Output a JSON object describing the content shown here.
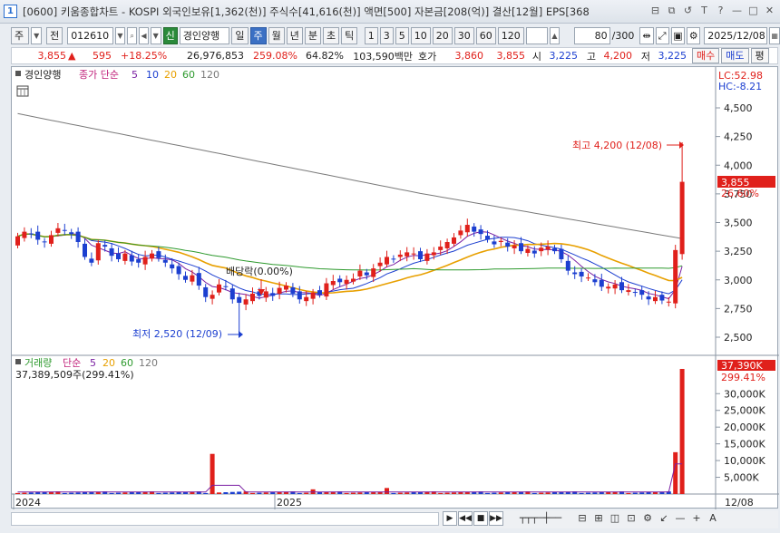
{
  "window": {
    "number": "1",
    "title": "[0600] 키움종합차트 - KOSPI 외국인보유[1,362(천)] 주식수[41,616(천)] 액면[500] 자본금[208(억)] 결산[12월] EPS[368",
    "controls": [
      "⊟",
      "⧉",
      "↺",
      "T",
      "?",
      "—",
      "□",
      "✕"
    ]
  },
  "toolbar": {
    "market": "주",
    "view": "전",
    "code": "012610",
    "sin": "신",
    "stock_name": "경인양행",
    "periods": [
      "일",
      "주",
      "월",
      "년",
      "분",
      "초",
      "틱"
    ],
    "selected_period": "주",
    "intervals": [
      "1",
      "3",
      "5",
      "10",
      "20",
      "30",
      "60",
      "120"
    ],
    "count": "80",
    "count_total": "/300",
    "date": "2025/12/08"
  },
  "quote": {
    "price": "3,855",
    "arrow": "▲",
    "change": "595",
    "change_pct": "+18.25%",
    "volume": "26,976,853",
    "volume_ratio": "259.08%",
    "strength": "64.82%",
    "amount": "103,590백만",
    "bid_label": "호가",
    "bid1": "3,860",
    "bid2": "3,855",
    "open_label": "시",
    "open": "3,225",
    "high_label": "고",
    "high": "4,200",
    "low_label": "저",
    "low": "3,225",
    "buy_label": "매수",
    "sell_label": "매도",
    "eval_label": "평"
  },
  "price_panel": {
    "legend_name": "경인양행",
    "legend_ma_label": "종가 단순",
    "ma_periods": [
      "5",
      "10",
      "20",
      "60",
      "120"
    ],
    "ma_colors": [
      "#7a1fa2",
      "#1c3fd0",
      "#e8a000",
      "#2e9a2e",
      "#7a7a7a"
    ],
    "lc": "LC:52.98",
    "hc": "HC:-8.21",
    "axis_ticks": [
      "4,500",
      "4,250",
      "4,000",
      "3,750",
      "3,500",
      "3,250",
      "3,000",
      "2,750",
      "2,500"
    ],
    "current_price": "3,855",
    "current_pct": "26.60%",
    "high_annotation": "최고 4,200 (12/08)",
    "low_annotation": "최저 2,520 (12/09)",
    "dividend_annotation": "배당락(0.00%)"
  },
  "volume_panel": {
    "legend_name": "거래량",
    "legend_ma_label": "단순",
    "ma_periods": [
      "5",
      "20",
      "60",
      "120"
    ],
    "ma_colors": [
      "#7a1fa2",
      "#e8a000",
      "#2e9a2e",
      "#7a7a7a"
    ],
    "volume_text": "37,389,509주(299.41%)",
    "axis_ticks": [
      "30,000K",
      "25,000K",
      "20,000K",
      "15,000K",
      "10,000K",
      "5,000K"
    ],
    "current_volume": "37,390K",
    "current_pct": "299.41%"
  },
  "x_axis": {
    "labels": [
      "2024",
      "2025"
    ],
    "end_label": "12/08"
  },
  "colors": {
    "up": "#e0201b",
    "down": "#1c3fd0",
    "accent": "#3b70c4"
  },
  "bottom": {
    "nav": [
      "▶",
      "◀◀",
      "■",
      "▶▶"
    ],
    "right_ctrls": [
      "⊟",
      "⊞",
      "◫",
      "⊡",
      "⚙",
      "↙",
      "—",
      "+",
      "A"
    ]
  }
}
